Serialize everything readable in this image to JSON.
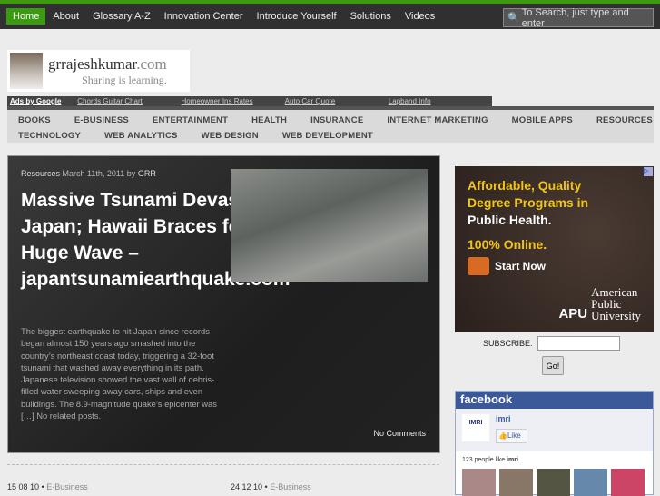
{
  "nav": {
    "items": [
      "Home",
      "About",
      "Glossary A-Z",
      "Innovation Center",
      "Introduce Yourself",
      "Solutions",
      "Videos"
    ],
    "search_placeholder": "To Search, just type and enter"
  },
  "logo": {
    "name": "grrajeshkumar",
    "tld": ".com",
    "tagline": "Sharing is learning."
  },
  "ads": {
    "label": "Ads by Google",
    "links": [
      "Chords Guitar Chart",
      "Homeowner Ins Rates",
      "Auto Car Quote",
      "Lapband Info"
    ]
  },
  "categories": [
    "BOOKS",
    "E-BUSINESS",
    "ENTERTAINMENT",
    "HEALTH",
    "INSURANCE",
    "INTERNET MARKETING",
    "MOBILE APPS",
    "RESOURCES",
    "TECHNOLOGY",
    "WEB ANALYTICS",
    "WEB DESIGN",
    "WEB DEVELOPMENT"
  ],
  "featured": {
    "category": "Resources",
    "date": "March 11th, 2011",
    "by": "by",
    "author": "GRR",
    "title": "Massive Tsunami Devastates Japan; Hawaii Braces for Huge Wave – japantsunamiearthquake.com",
    "excerpt": "The biggest earthquake to hit Japan since records began almost 150 years ago smashed into the country’s northeast coast today, triggering a 32-foot tsunami that washed away everything in its path. Japanese television showed the vast wall of debris-filled water sweeping away cars, ships and even buildings. The 8.9-magnitude quake’s epicenter was […] No related posts.",
    "comments": "No Comments"
  },
  "recent": [
    {
      "date": "15 08 10",
      "sep": " • ",
      "category": "E-Business"
    },
    {
      "date": "24 12 10",
      "sep": " • ",
      "category": "E-Business"
    }
  ],
  "sidebar_ad": {
    "line1": "Affordable, Quality",
    "line2": "Degree Programs in",
    "line3": "Public Health.",
    "line4": "100% Online.",
    "cta": "Start Now",
    "brand": "APU",
    "brand_name1": "American",
    "brand_name2": "Public",
    "brand_name3": "University"
  },
  "subscribe": {
    "label": "SUBSCRIBE:",
    "value": "",
    "button": "Go!"
  },
  "facebook": {
    "header": "facebook",
    "page": "imri",
    "logo_text": "IMRI",
    "like": "Like",
    "count_text": "123 people like ",
    "count_page": "imri",
    "count_end": "."
  }
}
